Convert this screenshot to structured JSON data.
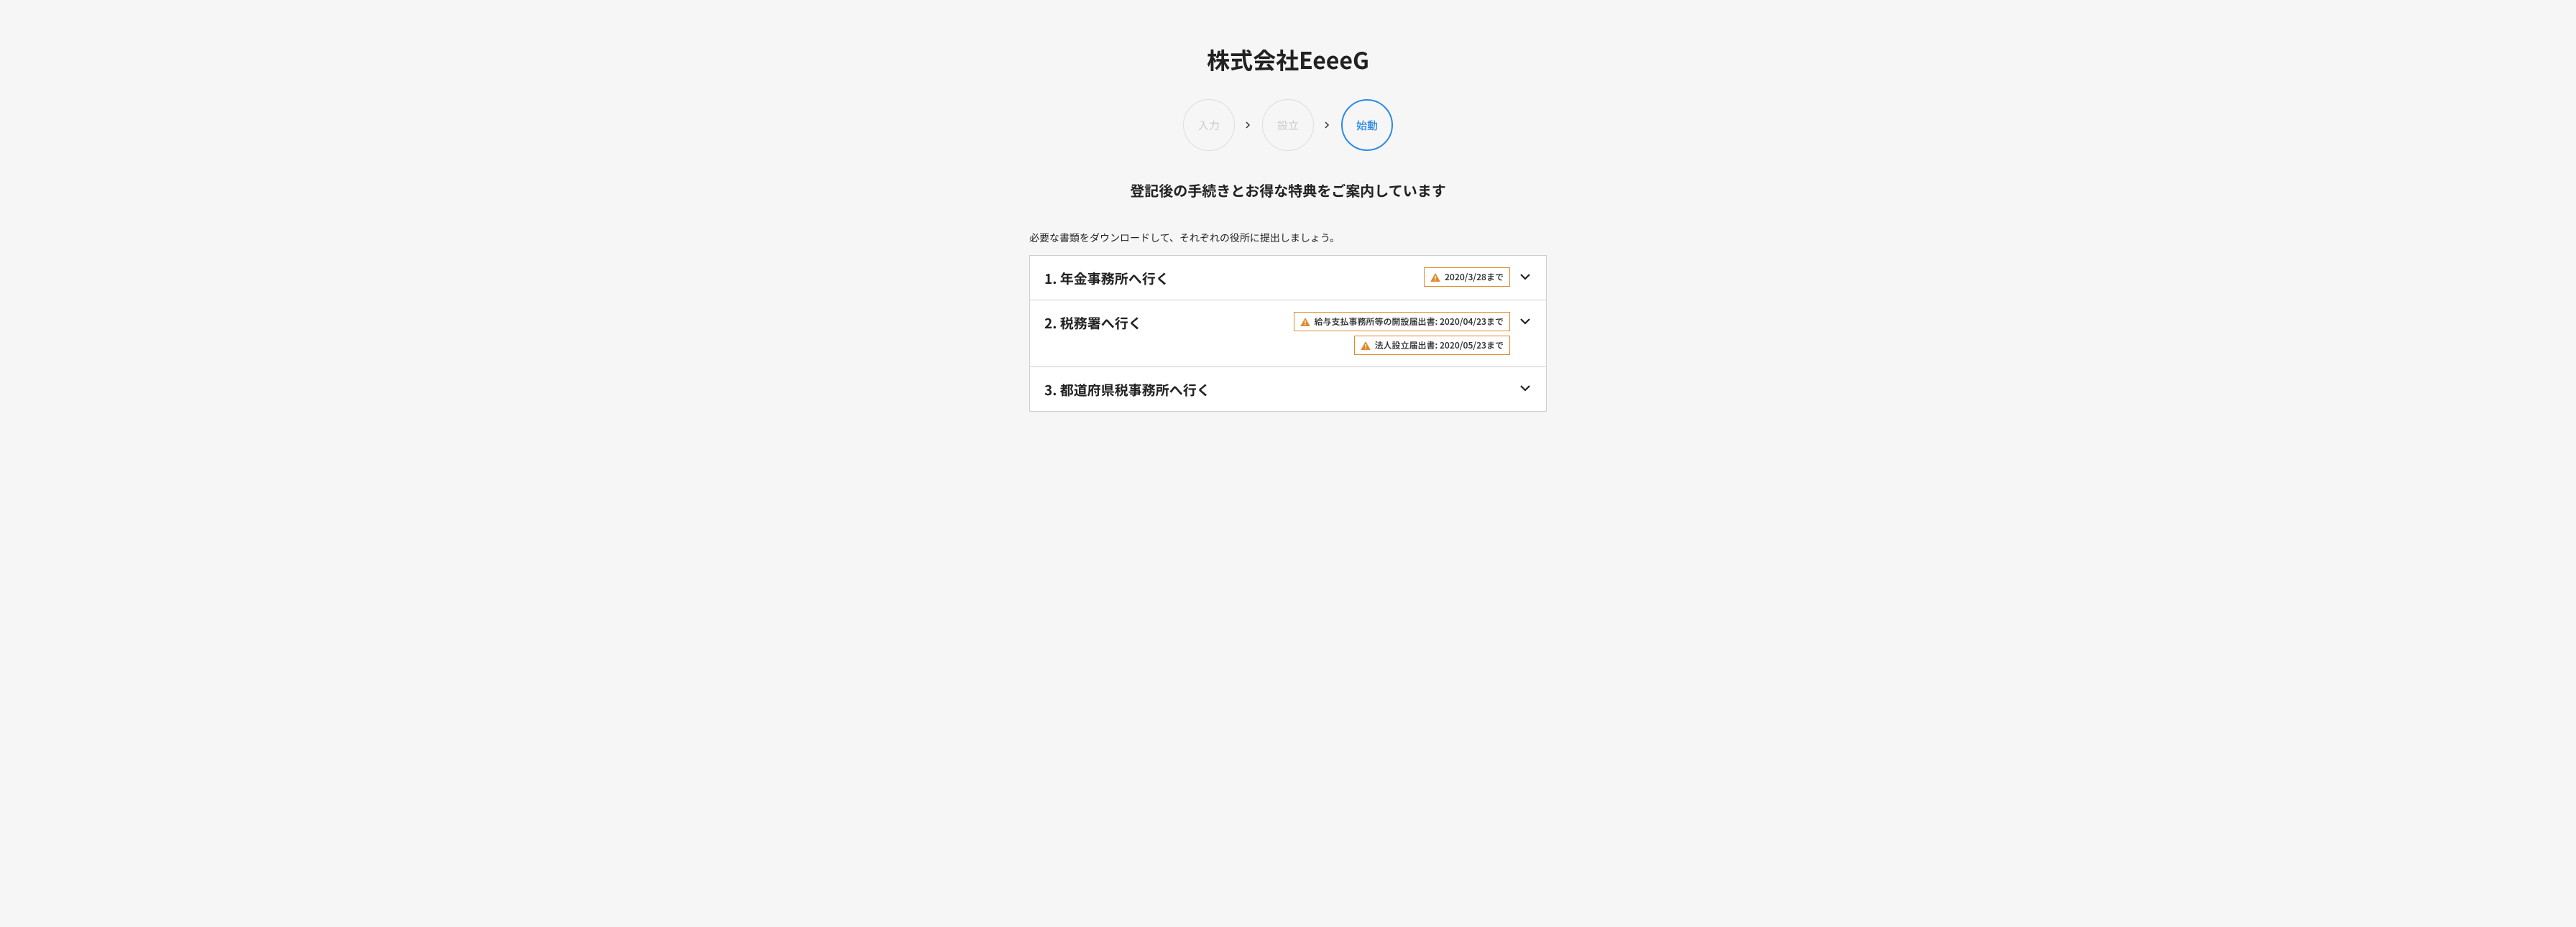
{
  "header": {
    "company_name": "株式会社EeeeG"
  },
  "steps": [
    {
      "label": "入力",
      "active": false
    },
    {
      "label": "設立",
      "active": false
    },
    {
      "label": "始動",
      "active": true
    }
  ],
  "subtitle": "登記後の手続きとお得な特典をご案内しています",
  "instructions": "必要な書類をダウンロードして、それぞれの役所に提出しましょう。",
  "accordion": [
    {
      "title": "1. 年金事務所へ行く",
      "badges": [
        {
          "text": "2020/3/28まで"
        }
      ]
    },
    {
      "title": "2. 税務署へ行く",
      "badges": [
        {
          "text": "給与支払事務所等の開設届出書: 2020/04/23まで"
        },
        {
          "text": "法人設立届出書: 2020/05/23まで"
        }
      ]
    },
    {
      "title": "3. 都道府県税事務所へ行く",
      "badges": []
    }
  ]
}
